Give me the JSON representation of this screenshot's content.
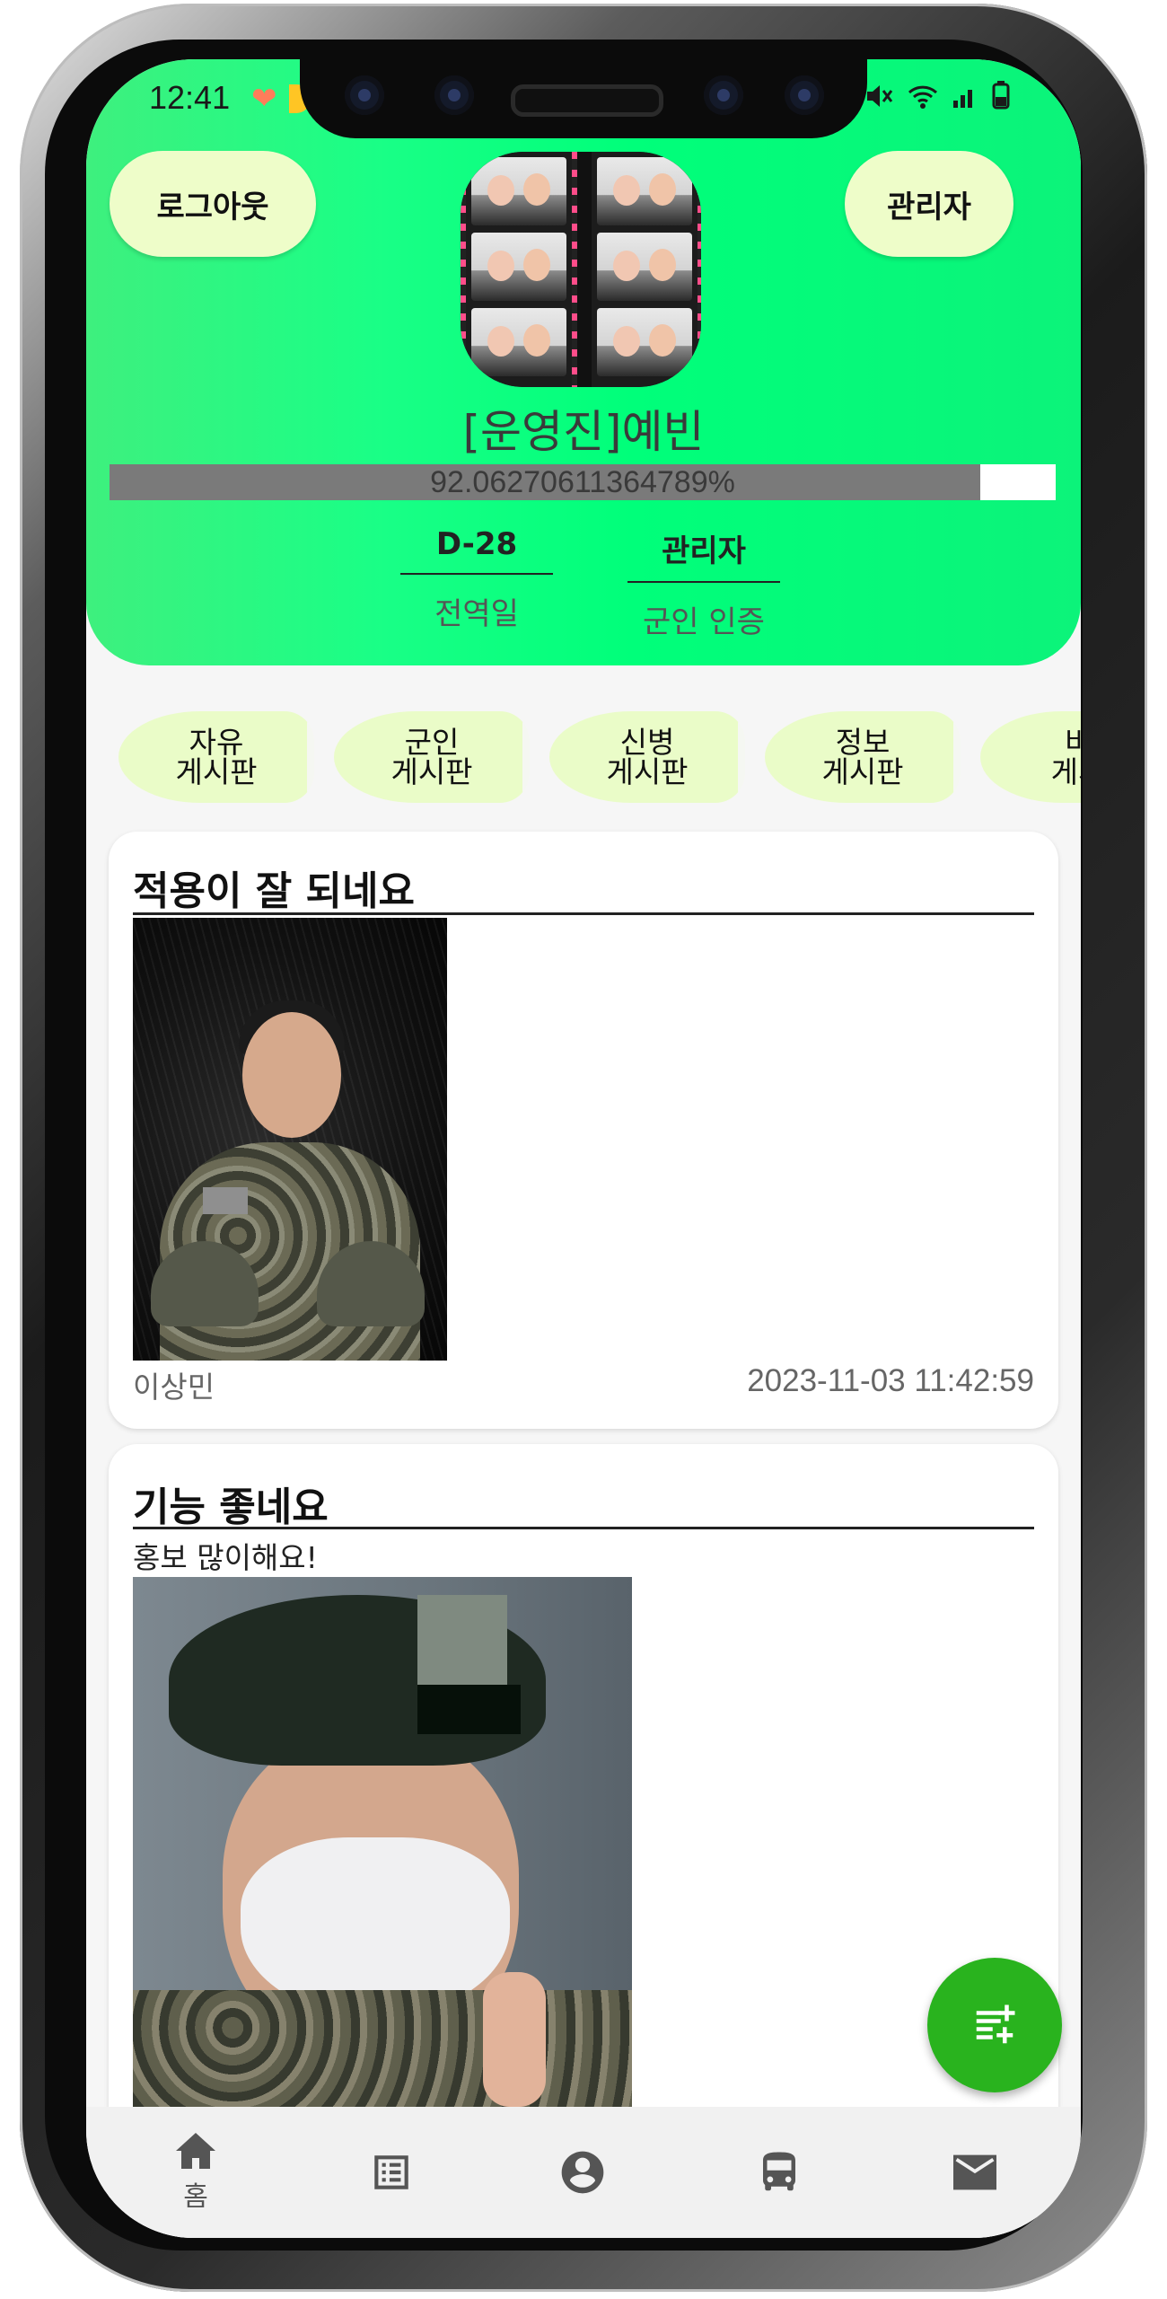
{
  "status_bar": {
    "time": "12:41"
  },
  "header": {
    "logout_label": "로그아웃",
    "admin_label": "관리자",
    "user_name": "[운영진]예빈",
    "progress": {
      "text": "92.06270611364789%",
      "percent": 92.06270611364789
    },
    "stats": [
      {
        "value": "D-28",
        "label": "전역일"
      },
      {
        "value": "관리자",
        "label": "군인 인증"
      }
    ]
  },
  "categories": [
    {
      "label": "자유\n게시판"
    },
    {
      "label": "군인\n게시판"
    },
    {
      "label": "신병\n게시판"
    },
    {
      "label": "정보\n게시판"
    },
    {
      "label": "비\n게시"
    }
  ],
  "posts": [
    {
      "title": "적용이 잘 되네요",
      "body": "",
      "author": "이상민",
      "date": "2023-11-03 11:42:59"
    },
    {
      "title": "기능 좋네요",
      "body": "홍보 많이해요!"
    }
  ],
  "bottom_nav": [
    {
      "icon": "home-icon",
      "label": "홈",
      "active": true
    },
    {
      "icon": "list-icon",
      "label": ""
    },
    {
      "icon": "account-icon",
      "label": ""
    },
    {
      "icon": "bus-icon",
      "label": ""
    },
    {
      "icon": "mail-icon",
      "label": ""
    }
  ],
  "colors": {
    "header_gradient_start": "#3ef07e",
    "header_gradient_end": "#0cf37a",
    "chip_background": "#eafcc8",
    "fab": "#29b31e",
    "progress_fill": "#7a7a7a"
  }
}
